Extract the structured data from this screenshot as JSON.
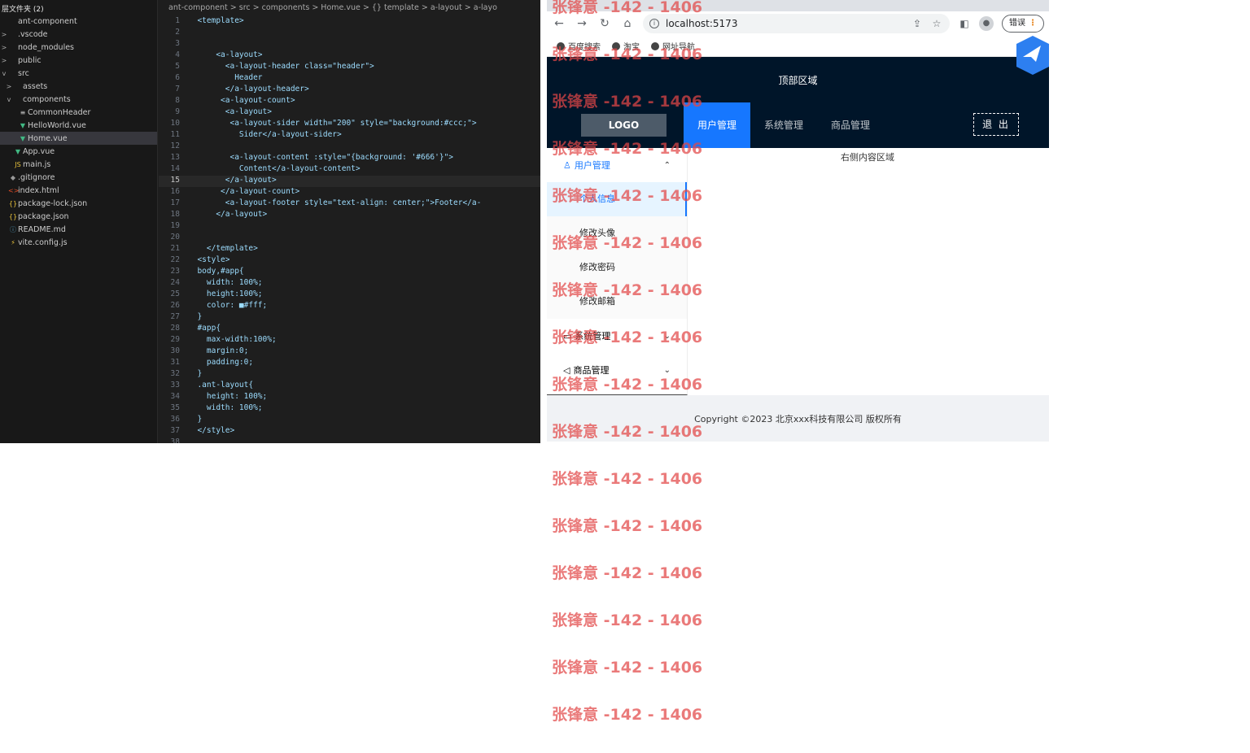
{
  "explorer": {
    "header": "层文件夹 (2)",
    "items": [
      {
        "label": "ant-component",
        "chev": "",
        "icon": "",
        "cls": ""
      },
      {
        "label": ".vscode",
        "chev": ">",
        "icon": "",
        "cls": ""
      },
      {
        "label": "node_modules",
        "chev": ">",
        "icon": "",
        "cls": ""
      },
      {
        "label": "public",
        "chev": ">",
        "icon": "",
        "cls": ""
      },
      {
        "label": "src",
        "chev": "v",
        "icon": "",
        "cls": ""
      },
      {
        "label": "assets",
        "chev": ">",
        "icon": "",
        "cls": ""
      },
      {
        "label": "components",
        "chev": "v",
        "icon": "",
        "cls": ""
      },
      {
        "label": "CommonHeader",
        "chev": "",
        "icon": "≡",
        "cls": ""
      },
      {
        "label": "HelloWorld.vue",
        "chev": "",
        "icon": "▼",
        "cls": "vue"
      },
      {
        "label": "Home.vue",
        "chev": "",
        "icon": "▼",
        "cls": "vue",
        "active": true
      },
      {
        "label": "App.vue",
        "chev": "",
        "icon": "▼",
        "cls": "vue"
      },
      {
        "label": "main.js",
        "chev": "",
        "icon": "JS",
        "cls": "js"
      },
      {
        "label": ".gitignore",
        "chev": "",
        "icon": "◆",
        "cls": "git"
      },
      {
        "label": "index.html",
        "chev": "",
        "icon": "<>",
        "cls": "html"
      },
      {
        "label": "package-lock.json",
        "chev": "",
        "icon": "{}",
        "cls": "json"
      },
      {
        "label": "package.json",
        "chev": "",
        "icon": "{}",
        "cls": "json"
      },
      {
        "label": "README.md",
        "chev": "",
        "icon": "ⓘ",
        "cls": "md"
      },
      {
        "label": "vite.config.js",
        "chev": "",
        "icon": "⚡",
        "cls": "js"
      }
    ]
  },
  "breadcrumb": "ant-component > src > components > Home.vue > {} template > a-layout > a-layo",
  "code_lines": [
    {
      "n": "1",
      "t": "  <template>"
    },
    {
      "n": "2",
      "t": ""
    },
    {
      "n": "3",
      "t": ""
    },
    {
      "n": "4",
      "t": "      <a-layout>"
    },
    {
      "n": "5",
      "t": "        <a-layout-header class=\"header\">"
    },
    {
      "n": "6",
      "t": "          Header"
    },
    {
      "n": "7",
      "t": "        </a-layout-header>"
    },
    {
      "n": "8",
      "t": "       <a-layout-count>"
    },
    {
      "n": "9",
      "t": "        <a-layout>"
    },
    {
      "n": "10",
      "t": "         <a-layout-sider width=\"200\" style=\"background:#ccc;\">"
    },
    {
      "n": "11",
      "t": "           Sider</a-layout-sider>"
    },
    {
      "n": "12",
      "t": ""
    },
    {
      "n": "13",
      "t": "         <a-layout-content :style=\"{background: '#666'}\">"
    },
    {
      "n": "14",
      "t": "           Content</a-layout-content>"
    },
    {
      "n": "15",
      "t": "        </a-layout>",
      "cur": true
    },
    {
      "n": "16",
      "t": "       </a-layout-count>"
    },
    {
      "n": "17",
      "t": "        <a-layout-footer style=\"text-align: center;\">Footer</a-"
    },
    {
      "n": "18",
      "t": "      </a-layout>"
    },
    {
      "n": "19",
      "t": ""
    },
    {
      "n": "20",
      "t": ""
    },
    {
      "n": "21",
      "t": "    </template>"
    },
    {
      "n": "22",
      "t": "  <style>"
    },
    {
      "n": "23",
      "t": "  body,#app{"
    },
    {
      "n": "24",
      "t": "    width: 100%;"
    },
    {
      "n": "25",
      "t": "    height:100%;"
    },
    {
      "n": "26",
      "t": "    color: ■#fff;"
    },
    {
      "n": "27",
      "t": "  }"
    },
    {
      "n": "28",
      "t": "  #app{"
    },
    {
      "n": "29",
      "t": "    max-width:100%;"
    },
    {
      "n": "30",
      "t": "    margin:0;"
    },
    {
      "n": "31",
      "t": "    padding:0;"
    },
    {
      "n": "32",
      "t": "  }"
    },
    {
      "n": "33",
      "t": "  .ant-layout{"
    },
    {
      "n": "34",
      "t": "    height: 100%;"
    },
    {
      "n": "35",
      "t": "    width: 100%;"
    },
    {
      "n": "36",
      "t": "  }"
    },
    {
      "n": "37",
      "t": "  </style>"
    },
    {
      "n": "38",
      "t": ""
    }
  ],
  "browser": {
    "url": "localhost:5173",
    "error_label": "错误",
    "bookmarks": [
      "百度搜索",
      "淘宝",
      "网址导航"
    ]
  },
  "app": {
    "top_area": "顶部区域",
    "logo": "LOGO",
    "menu": [
      {
        "label": "用户管理",
        "selected": true
      },
      {
        "label": "系统管理"
      },
      {
        "label": "商品管理"
      }
    ],
    "logout": "退 出",
    "sider": {
      "user_mgmt": "用户管理",
      "user_items": [
        "个人信息",
        "修改头像",
        "修改密码",
        "修改邮箱"
      ],
      "system_mgmt": "系统管理",
      "goods_mgmt": "商品管理"
    },
    "content_label": "右侧内容区域",
    "footer": "Copyright ©2023 北京xxx科技有限公司 版权所有"
  },
  "watermark": "张锋意 -142 - 1406",
  "colors": {
    "header_bg": "#001529",
    "accent": "#1677ff",
    "watermark": "#e24646"
  }
}
